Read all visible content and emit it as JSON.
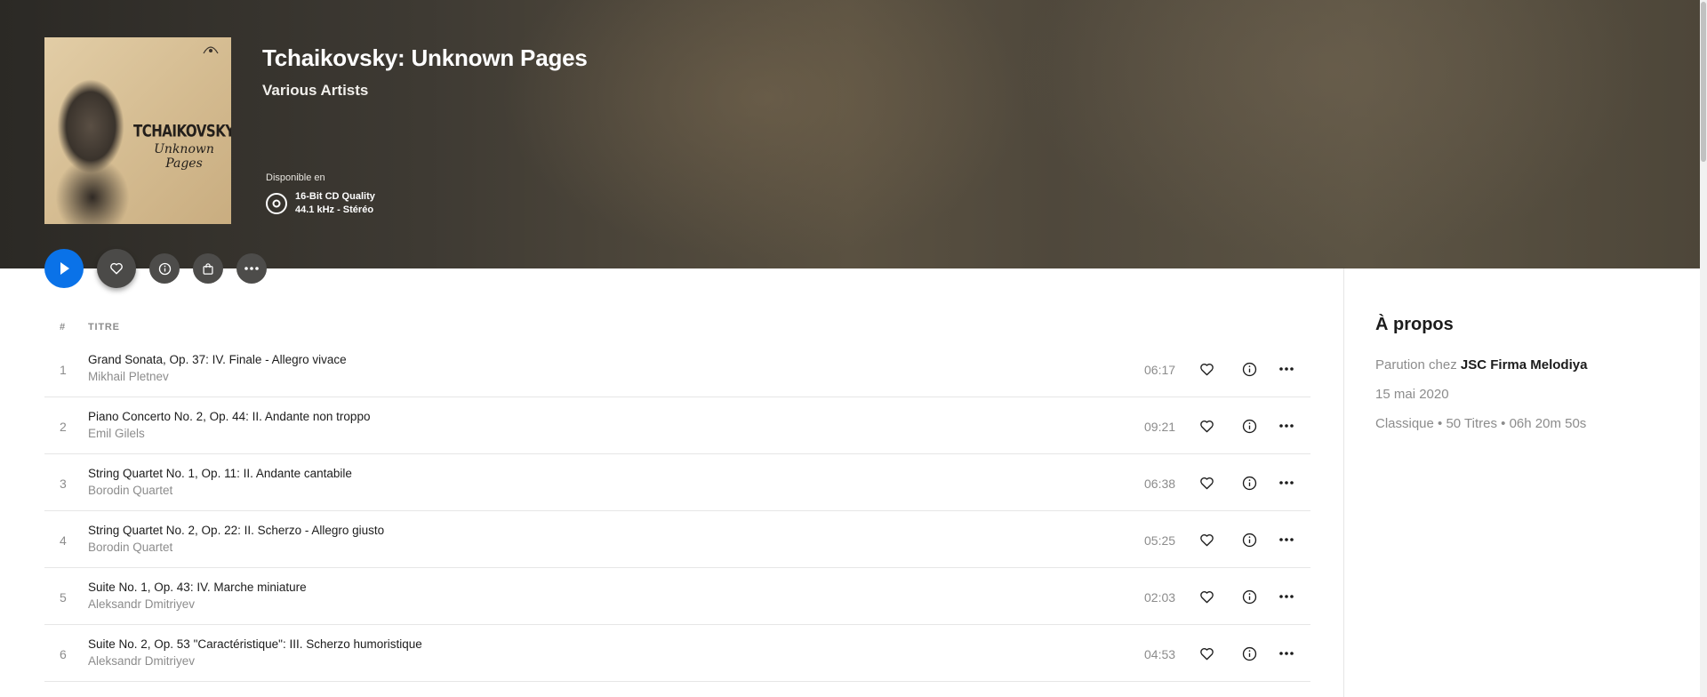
{
  "album": {
    "title": "Tchaikovsky: Unknown Pages",
    "artist": "Various Artists",
    "cover_title": "TCHAIKOVSKY",
    "cover_subtitle": "Unknown Pages",
    "available_label": "Disponible en",
    "quality_line1": "16-Bit CD Quality",
    "quality_line2": "44.1 kHz - Stéréo"
  },
  "actions": {
    "play_icon": "play-icon",
    "favorite_icon": "heart-icon",
    "info_icon": "info-icon",
    "shop_icon": "shopping-bag-icon",
    "more_icon": "more-icon"
  },
  "table": {
    "col_number": "#",
    "col_title": "TITRE"
  },
  "tracks": [
    {
      "num": "1",
      "title": "Grand Sonata, Op. 37: IV. Finale - Allegro vivace",
      "artist": "Mikhail Pletnev",
      "duration": "06:17"
    },
    {
      "num": "2",
      "title": "Piano Concerto No. 2, Op. 44: II. Andante non troppo",
      "artist": "Emil Gilels",
      "duration": "09:21"
    },
    {
      "num": "3",
      "title": "String Quartet No. 1, Op. 11: II. Andante cantabile",
      "artist": "Borodin Quartet",
      "duration": "06:38"
    },
    {
      "num": "4",
      "title": "String Quartet No. 2, Op. 22: II. Scherzo - Allegro giusto",
      "artist": "Borodin Quartet",
      "duration": "05:25"
    },
    {
      "num": "5",
      "title": "Suite No. 1, Op. 43: IV. Marche miniature",
      "artist": "Aleksandr Dmitriyev",
      "duration": "02:03"
    },
    {
      "num": "6",
      "title": "Suite No. 2, Op. 53 \"Caractéristique\": III. Scherzo humoristique",
      "artist": "Aleksandr Dmitriyev",
      "duration": "04:53"
    }
  ],
  "about": {
    "title": "À propos",
    "label_prefix": "Parution chez",
    "label": "JSC Firma Melodiya",
    "date": "15 mai 2020",
    "meta": "Classique • 50 Titres • 06h 20m 50s"
  },
  "colors": {
    "accent": "#0a72e8",
    "muted_text": "#8c8c8c"
  }
}
